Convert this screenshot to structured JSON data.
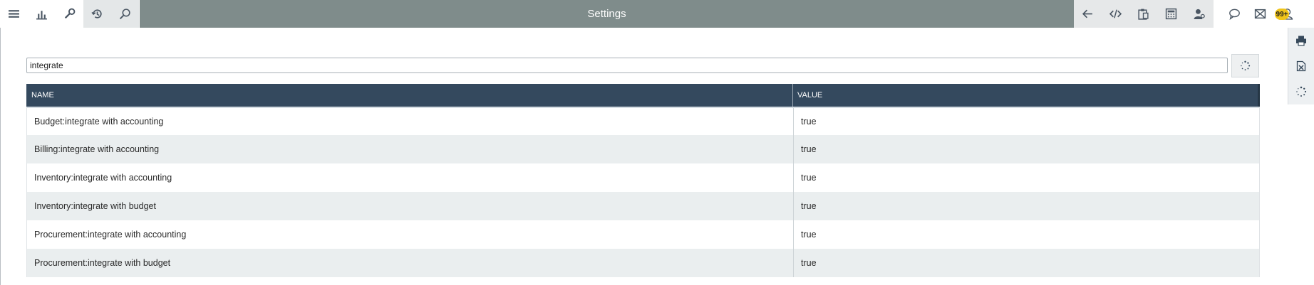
{
  "header": {
    "title": "Settings"
  },
  "toolbar_left": [
    "menu-icon",
    "chart-icon",
    "tools-icon",
    "history-icon",
    "search-icon"
  ],
  "toolbar_right": [
    "back-icon",
    "code-icon",
    "clipboard-icon",
    "calculator-icon",
    "user-settings-icon"
  ],
  "toolbar_far": [
    "chat-icon",
    "mail-icon",
    "user-icon"
  ],
  "notifications": {
    "count": "99+"
  },
  "side_tools": [
    "print-icon",
    "excel-icon",
    "refresh-icon"
  ],
  "search": {
    "value": "integrate"
  },
  "grid": {
    "columns": [
      "NAME",
      "VALUE"
    ],
    "rows": [
      {
        "name": "Budget:integrate with accounting",
        "value": "true"
      },
      {
        "name": "Billing:integrate with accounting",
        "value": "true"
      },
      {
        "name": "Inventory:integrate with accounting",
        "value": "true"
      },
      {
        "name": "Inventory:integrate with budget",
        "value": "true"
      },
      {
        "name": "Procurement:integrate with accounting",
        "value": "true"
      },
      {
        "name": "Procurement:integrate with budget",
        "value": "true"
      }
    ]
  },
  "colors": {
    "title_bar": "#7f8c8b",
    "grid_header": "#34495e",
    "badge": "#f0c419"
  }
}
